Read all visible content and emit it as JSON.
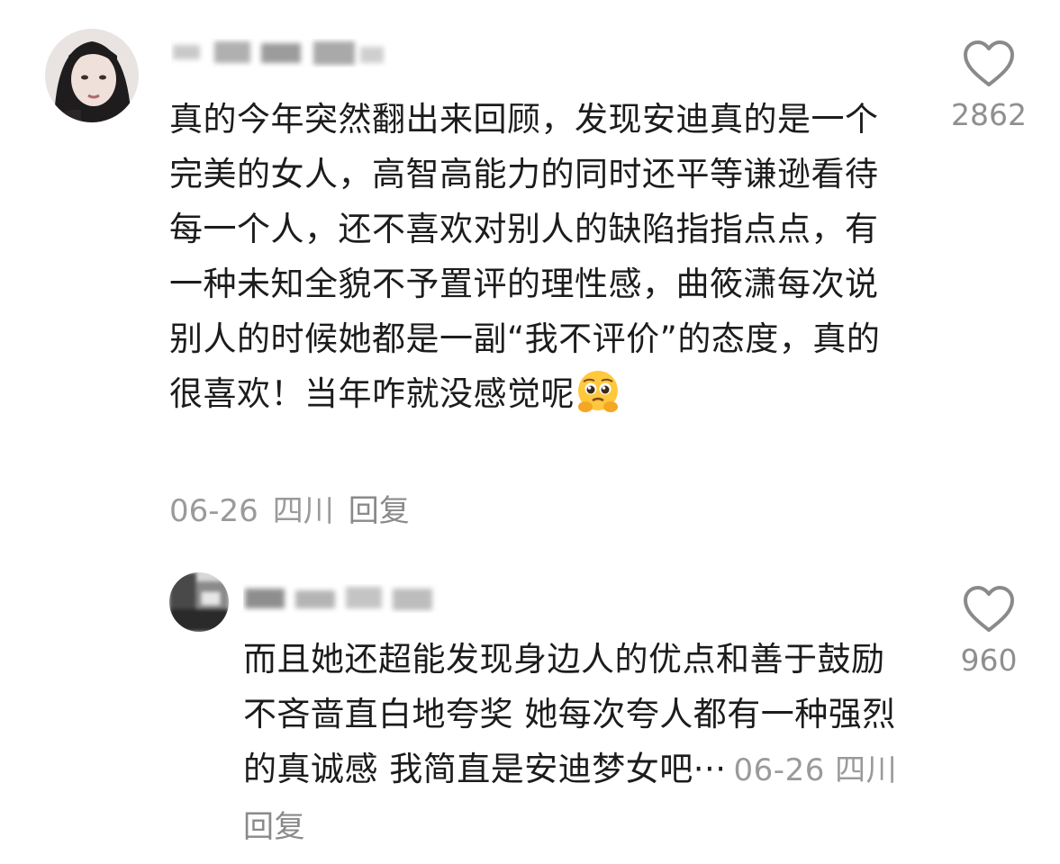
{
  "comments": [
    {
      "username": "",
      "text": "真的今年突然翻出来回顾，发现安迪真的是一个完美的女人，高智高能力的同时还平等谦逊看待每一个人，还不喜欢对别人的缺陷指指点点，有一种未知全貌不予置评的理性感，曲筱潇每次说别人的时候她都是一副“我不评价”的态度，真的很喜欢！当年咋就没感觉呢",
      "emoji": "pleading-face-emoji",
      "date": "06-26",
      "location": "四川",
      "reply_label": "回复",
      "likes": "2862"
    },
    {
      "username": "",
      "text": "而且她还超能发现身边人的优点和善于鼓励 不吝啬直白地夸奖 她每次夸人都有一种强烈的真诚感 我简直是安迪梦女吧···",
      "date": "06-26",
      "location": "四川",
      "reply_label": "回复",
      "likes": "960"
    }
  ],
  "icons": {
    "like": "heart-outline-icon"
  },
  "colors": {
    "text": "#1c1c1c",
    "meta": "#9a9a9a",
    "icon": "#8a8a8a"
  }
}
